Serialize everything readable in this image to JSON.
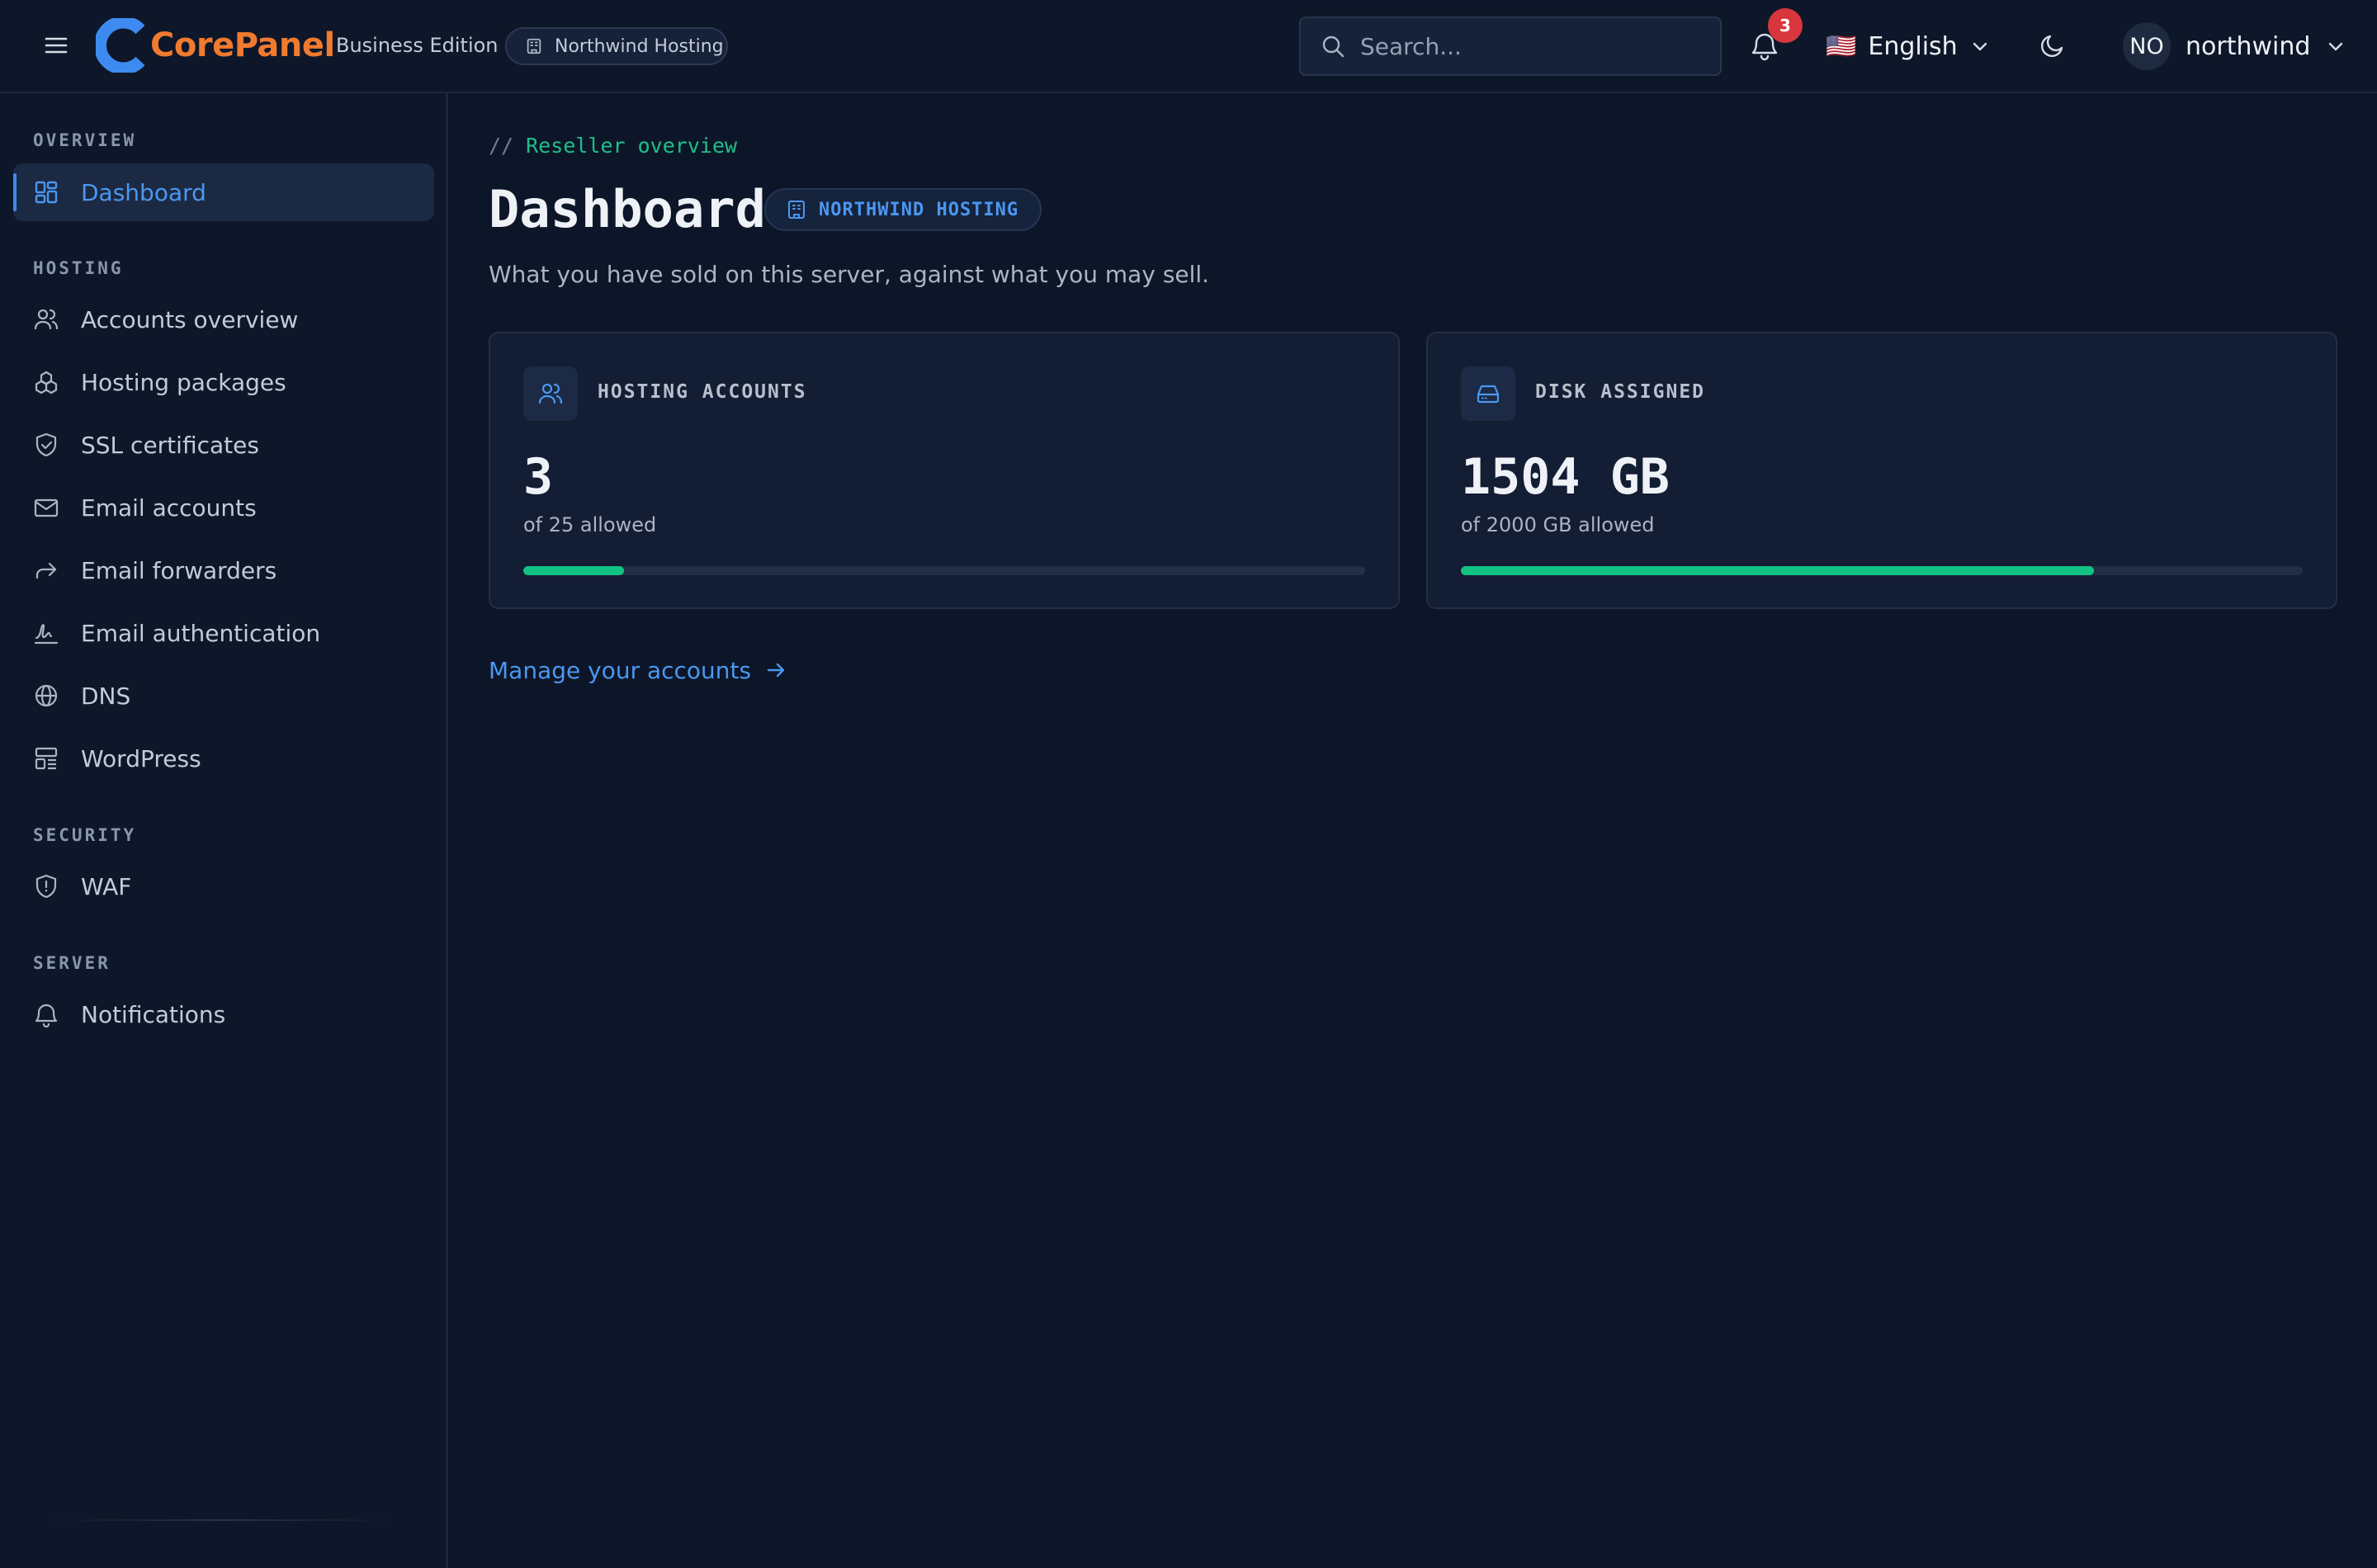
{
  "header": {
    "brand": "CorePanel",
    "edition": "Business Edition",
    "org_pill": "Northwind Hosting",
    "search_placeholder": "Search...",
    "notification_count": "3",
    "language_flag": "🇺🇸",
    "language": "English",
    "user_initials": "NO",
    "username": "northwind"
  },
  "sidebar": {
    "sections": [
      {
        "label": "OVERVIEW",
        "items": [
          {
            "label": "Dashboard",
            "icon": "dashboard-icon",
            "active": true
          }
        ]
      },
      {
        "label": "HOSTING",
        "items": [
          {
            "label": "Accounts overview",
            "icon": "users-icon"
          },
          {
            "label": "Hosting packages",
            "icon": "packages-icon"
          },
          {
            "label": "SSL certificates",
            "icon": "shield-check-icon"
          },
          {
            "label": "Email accounts",
            "icon": "mail-icon"
          },
          {
            "label": "Email forwarders",
            "icon": "forward-icon"
          },
          {
            "label": "Email authentication",
            "icon": "signature-icon"
          },
          {
            "label": "DNS",
            "icon": "globe-icon"
          },
          {
            "label": "WordPress",
            "icon": "layout-icon"
          }
        ]
      },
      {
        "label": "SECURITY",
        "items": [
          {
            "label": "WAF",
            "icon": "shield-alert-icon"
          }
        ]
      },
      {
        "label": "SERVER",
        "items": [
          {
            "label": "Notifications",
            "icon": "bell-icon"
          }
        ]
      }
    ]
  },
  "main": {
    "breadcrumb_prefix": "//",
    "breadcrumb": "Reseller overview",
    "title": "Dashboard",
    "title_badge": "NORTHWIND HOSTING",
    "subtitle": "What you have sold on this server, against what you may sell.",
    "cards": [
      {
        "label": "HOSTING ACCOUNTS",
        "value": "3",
        "sub": "of 25 allowed",
        "fraction": 0.12,
        "icon": "users-icon"
      },
      {
        "label": "DISK ASSIGNED",
        "value": "1504 GB",
        "sub": "of 2000 GB allowed",
        "fraction": 0.752,
        "icon": "hard-drive-icon"
      }
    ],
    "manage_link": "Manage your accounts"
  },
  "colors": {
    "background": "#0d1628",
    "accent": "#4b97f0",
    "brand": "#f07a2e",
    "success": "#12c283",
    "badge": "#d8363d"
  }
}
